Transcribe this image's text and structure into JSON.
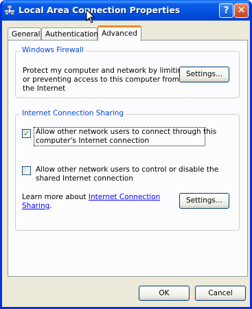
{
  "window": {
    "title": "Local Area Connection Properties",
    "help_glyph": "?",
    "close_glyph": "✕"
  },
  "tabs": [
    {
      "label": "General",
      "active": false
    },
    {
      "label": "Authentication",
      "active": false
    },
    {
      "label": "Advanced",
      "active": true
    }
  ],
  "firewall": {
    "group_title": "Windows Firewall",
    "line1": "Protect my computer and network by limiting",
    "line2": "or preventing access to this computer from",
    "line3": "the Internet",
    "settings_label": "Settings..."
  },
  "ics": {
    "group_title": "Internet Connection Sharing",
    "allow_connect_line1": "Allow other network users to connect through this",
    "allow_connect_line2": "computer's Internet connection",
    "allow_connect_checked": true,
    "allow_control_line1": "Allow other network users to control or disable the",
    "allow_control_line2": "shared Internet connection",
    "allow_control_checked": false,
    "learn_prefix": "Learn more about ",
    "learn_link_line1": "Internet Connection",
    "learn_link_line2": "Sharing",
    "learn_suffix": ".",
    "settings_label": "Settings..."
  },
  "footer": {
    "ok_label": "OK",
    "cancel_label": "Cancel"
  },
  "colors": {
    "titlebar": "#0553e0",
    "group_title": "#0046d5",
    "active_tab_accent": "#e68b2c",
    "link": "#0000ff",
    "checkmark": "#21a121"
  },
  "icons": {
    "title": "network-connection-icon",
    "help": "help-icon",
    "close": "close-icon",
    "check": "checkmark-icon"
  }
}
